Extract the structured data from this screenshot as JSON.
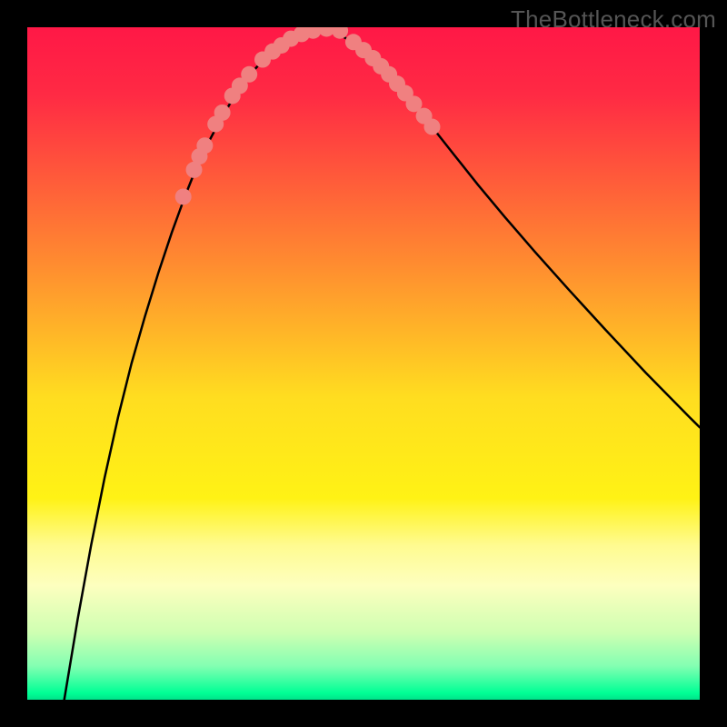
{
  "watermark": "TheBottleneck.com",
  "chart_data": {
    "type": "line",
    "title": "",
    "xlabel": "",
    "ylabel": "",
    "xlim": [
      0,
      1
    ],
    "ylim": [
      0,
      1
    ],
    "background": {
      "type": "vertical-gradient",
      "stops": [
        {
          "offset": 0.0,
          "color": "#ff1846"
        },
        {
          "offset": 0.1,
          "color": "#ff2a44"
        },
        {
          "offset": 0.35,
          "color": "#ff8b30"
        },
        {
          "offset": 0.55,
          "color": "#ffdd20"
        },
        {
          "offset": 0.7,
          "color": "#fff215"
        },
        {
          "offset": 0.77,
          "color": "#fffb90"
        },
        {
          "offset": 0.83,
          "color": "#fdffbf"
        },
        {
          "offset": 0.9,
          "color": "#cfffb2"
        },
        {
          "offset": 0.95,
          "color": "#83ffb2"
        },
        {
          "offset": 0.99,
          "color": "#00ff95"
        },
        {
          "offset": 1.0,
          "color": "#00e28a"
        }
      ]
    },
    "series": [
      {
        "name": "curve",
        "stroke": "#000000",
        "stroke_width": 2.5,
        "x": [
          0.055,
          0.075,
          0.095,
          0.115,
          0.135,
          0.155,
          0.175,
          0.195,
          0.215,
          0.235,
          0.255,
          0.27,
          0.285,
          0.3,
          0.315,
          0.33,
          0.345,
          0.36,
          0.372,
          0.384,
          0.396,
          0.408,
          0.42,
          0.432,
          0.444,
          0.456,
          0.468,
          0.48,
          0.495,
          0.51,
          0.525,
          0.54,
          0.56,
          0.58,
          0.605,
          0.635,
          0.67,
          0.71,
          0.755,
          0.805,
          0.86,
          0.92,
          0.985,
          1.0
        ],
        "y": [
          0.0,
          0.12,
          0.23,
          0.33,
          0.42,
          0.5,
          0.57,
          0.635,
          0.695,
          0.75,
          0.8,
          0.83,
          0.858,
          0.884,
          0.908,
          0.928,
          0.945,
          0.96,
          0.97,
          0.978,
          0.985,
          0.991,
          0.995,
          0.998,
          0.996,
          0.993,
          0.987,
          0.98,
          0.97,
          0.958,
          0.944,
          0.928,
          0.905,
          0.88,
          0.848,
          0.81,
          0.766,
          0.718,
          0.666,
          0.61,
          0.55,
          0.486,
          0.42,
          0.405
        ]
      }
    ],
    "markers": {
      "name": "highlight-dots",
      "color": "#f08080",
      "radius": 9,
      "x": [
        0.232,
        0.248,
        0.256,
        0.264,
        0.28,
        0.29,
        0.305,
        0.316,
        0.33,
        0.35,
        0.365,
        0.378,
        0.392,
        0.408,
        0.425,
        0.445,
        0.465,
        0.485,
        0.5,
        0.514,
        0.526,
        0.538,
        0.55,
        0.562,
        0.575,
        0.59,
        0.602
      ],
      "y": [
        0.748,
        0.788,
        0.808,
        0.824,
        0.856,
        0.873,
        0.898,
        0.913,
        0.93,
        0.952,
        0.964,
        0.973,
        0.983,
        0.99,
        0.995,
        0.998,
        0.995,
        0.978,
        0.966,
        0.954,
        0.942,
        0.93,
        0.916,
        0.902,
        0.886,
        0.868,
        0.852
      ]
    }
  }
}
